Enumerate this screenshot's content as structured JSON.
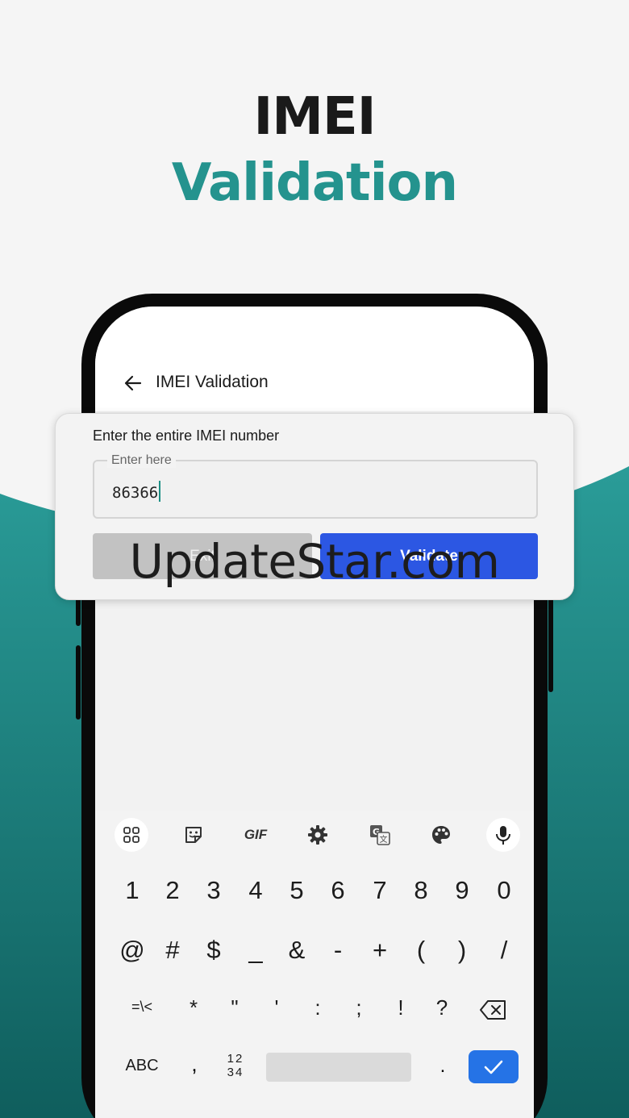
{
  "colors": {
    "accent_teal": "#24938e",
    "validate_blue": "#2c57e3",
    "enter_blue": "#2573e6"
  },
  "hero": {
    "title_line1": "IMEI",
    "title_line2": "Validation"
  },
  "app_bar": {
    "back_icon": "arrow-left-icon",
    "title": "IMEI Validation"
  },
  "dialog": {
    "label": "Enter the entire IMEI number",
    "input": {
      "placeholder": "Enter here",
      "value": "86366"
    },
    "exit_button": "Exit",
    "validate_button": "Validate"
  },
  "watermark": "UpdateStar.com",
  "keyboard": {
    "toolbar_icons": [
      "apps-grid-icon",
      "sticker-icon",
      "gif-icon",
      "gear-icon",
      "translate-icon",
      "palette-icon",
      "microphone-icon"
    ],
    "toolbar_gif_label": "GIF",
    "row1": [
      "1",
      "2",
      "3",
      "4",
      "5",
      "6",
      "7",
      "8",
      "9",
      "0"
    ],
    "row2": [
      "@",
      "#",
      "$",
      "_",
      "&",
      "-",
      "+",
      "(",
      ")",
      "/"
    ],
    "row3": [
      "=\\<",
      "*",
      "\"",
      "'",
      ":",
      ";",
      "!",
      "?"
    ],
    "row3_backspace_icon": "backspace-icon",
    "abc_label": "ABC",
    "comma": ",",
    "numpad_toggle_top": "12",
    "numpad_toggle_bottom": "34",
    "period": ".",
    "enter_icon": "check-icon"
  }
}
